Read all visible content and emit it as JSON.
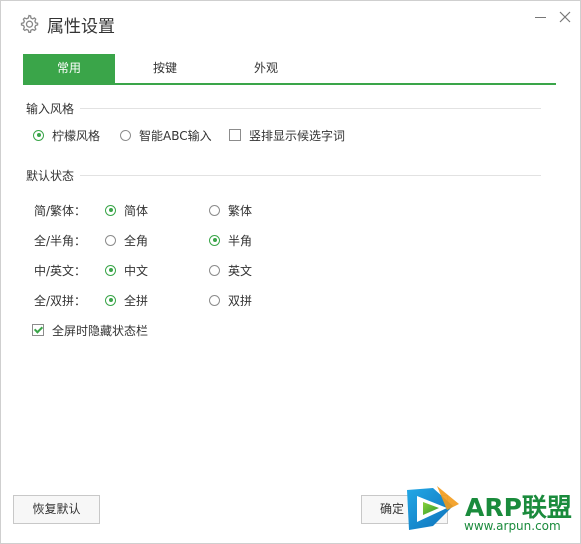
{
  "window": {
    "title": "属性设置"
  },
  "tabs": [
    {
      "label": "常用",
      "active": true
    },
    {
      "label": "按键",
      "active": false
    },
    {
      "label": "外观",
      "active": false
    }
  ],
  "input_style": {
    "title": "输入风格",
    "options": [
      {
        "label": "柠檬风格",
        "checked": true
      },
      {
        "label": "智能ABC输入",
        "checked": false
      },
      {
        "label": "竖排显示候选字词",
        "checked": false
      }
    ]
  },
  "default_state": {
    "title": "默认状态",
    "rows": [
      {
        "label": "简/繁体：",
        "options": [
          {
            "label": "简体",
            "checked": true
          },
          {
            "label": "繁体",
            "checked": false
          }
        ]
      },
      {
        "label": "全/半角：",
        "options": [
          {
            "label": "全角",
            "checked": false
          },
          {
            "label": "半角",
            "checked": true
          }
        ]
      },
      {
        "label": "中/英文：",
        "options": [
          {
            "label": "中文",
            "checked": true
          },
          {
            "label": "英文",
            "checked": false
          }
        ]
      },
      {
        "label": "全/双拼：",
        "options": [
          {
            "label": "全拼",
            "checked": true
          },
          {
            "label": "双拼",
            "checked": false
          }
        ]
      }
    ],
    "hide_status_bar": {
      "label": "全屏时隐藏状态栏",
      "checked": true
    }
  },
  "buttons": {
    "restore_default": "恢复默认",
    "ok": "确定"
  },
  "watermark": {
    "brand": "ARP联盟",
    "url": "www.arpun.com"
  },
  "colors": {
    "accent": "#3aa549",
    "watermark": "#1a8b3c"
  },
  "icons": {
    "title": "gear-icon",
    "minimize": "minimize-icon",
    "close": "close-icon"
  }
}
